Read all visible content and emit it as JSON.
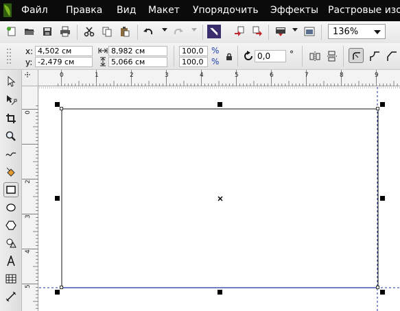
{
  "menu": {
    "items": [
      "Файл",
      "Правка",
      "Вид",
      "Макет",
      "Упорядочить",
      "Эффекты",
      "Растровые изоб"
    ]
  },
  "toolbar": {
    "zoom_value": "136%"
  },
  "property_bar": {
    "x_label": "x:",
    "y_label": "y:",
    "x_value": "4,502 см",
    "y_value": "-2,479 см",
    "width_value": "8,982 см",
    "height_value": "5,066 см",
    "scale_x": "100,0",
    "scale_y": "100,0",
    "percent_symbol": "%",
    "rotation_value": "0,0",
    "degree_symbol": "°"
  },
  "ruler": {
    "horizontal_labels": [
      "0",
      "1",
      "2",
      "3",
      "4",
      "5",
      "6",
      "7",
      "8",
      "9"
    ],
    "vertical_labels": [
      "0",
      "1",
      "2",
      "3",
      "4",
      "5"
    ]
  },
  "colors": {
    "menubar_bg": "#0b0b0b",
    "guideline": "#1a2fa0",
    "logo_green": "#7ab51d"
  },
  "icons": {
    "toolbar": [
      "new-document-icon",
      "open-folder-icon",
      "save-icon",
      "print-icon",
      "cut-icon",
      "copy-icon",
      "paste-icon",
      "undo-icon",
      "redo-icon",
      "import-icon",
      "export-icon",
      "publish-icon",
      "application-launcher-icon",
      "welcome-screen-icon"
    ],
    "toolbox": [
      "pick-tool-icon",
      "shape-tool-icon",
      "crop-tool-icon",
      "zoom-tool-icon",
      "freehand-tool-icon",
      "smart-fill-icon",
      "rectangle-tool-icon",
      "ellipse-tool-icon",
      "polygon-tool-icon",
      "basic-shapes-icon",
      "text-tool-icon",
      "table-tool-icon",
      "dimension-tool-icon"
    ]
  }
}
